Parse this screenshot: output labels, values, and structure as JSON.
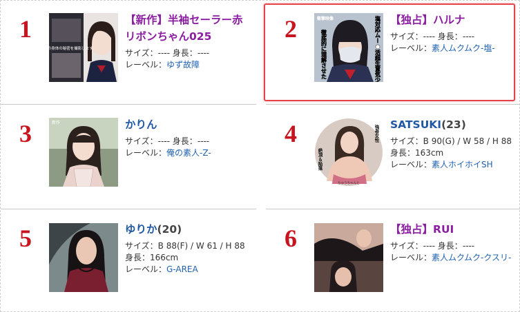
{
  "items": [
    {
      "rank": "1",
      "title_tag": "【新作】",
      "title_name": "半袖セーラー赤リボンちゃん025",
      "title_suffix": "",
      "size_label": "サイズ：",
      "size_value": "----",
      "height_label": "身長：",
      "height_value": "----",
      "label_label": "レーベル：",
      "label_value": "ゆず故障",
      "title_color": "purple",
      "image_desc": "schoolgirl-thumbnail"
    },
    {
      "rank": "2",
      "title_tag": "【独占】",
      "title_name": "ハルナ",
      "title_suffix": "",
      "size_label": "サイズ：",
      "size_value": "----",
      "height_label": "身長：",
      "height_value": "----",
      "label_label": "レーベル：",
      "label_value": "素人ムクムク-塩-",
      "title_color": "purple",
      "image_desc": "masked-girl-thumbnail"
    },
    {
      "rank": "3",
      "title_tag": "",
      "title_name": "かりん",
      "title_suffix": "",
      "size_label": "サイズ：",
      "size_value": "----",
      "height_label": "身長：",
      "height_value": "----",
      "label_label": "レーベル：",
      "label_value": "俺の素人-Z-",
      "title_color": "blue",
      "image_desc": "outdoor-girl-thumbnail"
    },
    {
      "rank": "4",
      "title_tag": "",
      "title_name": "SATSUKI",
      "title_suffix": "(23)",
      "size_label": "サイズ：",
      "size_value": "B 90(G) / W 58 / H 88",
      "height_label": "身長：",
      "height_value": "163cm",
      "label_label": "レーベル：",
      "label_value": "素人ホイホイSH",
      "title_color": "blue",
      "image_desc": "round-portrait-thumbnail"
    },
    {
      "rank": "5",
      "title_tag": "",
      "title_name": "ゆりか",
      "title_suffix": "(20)",
      "size_label": "サイズ：",
      "size_value": "B 88(F) / W 61 / H 88",
      "height_label": "身長：",
      "height_value": "166cm",
      "label_label": "レーベル：",
      "label_value": "G-AREA",
      "title_color": "blue",
      "image_desc": "umbrella-girl-thumbnail"
    },
    {
      "rank": "6",
      "title_tag": "【独占】",
      "title_name": "RUI",
      "title_suffix": "",
      "size_label": "サイズ：",
      "size_value": "----",
      "height_label": "身長：",
      "height_value": "----",
      "label_label": "レーベル：",
      "label_value": "素人ムクムク-クスリ-",
      "title_color": "purple",
      "image_desc": "collage-thumbnail"
    }
  ],
  "thumb_overlay_text": {
    "item1": "女の子の身体の秘密を撮影します。",
    "item2_top": "衝撃映像",
    "item2_left": "徹底的に理解させた",
    "item2_right": "塩対応ムー●活超生意気少女を",
    "item4_right": "強者女性",
    "item4_left": "絶頂＆陥落",
    "item4_bottom": "ちゅうちゃんと",
    "item3_corner": "新作"
  },
  "colors": {
    "rank": "#c8141e",
    "title_purple": "#8a1da0",
    "title_blue": "#2158a6",
    "link": "#2162b0",
    "highlight_border": "#e5424e"
  }
}
